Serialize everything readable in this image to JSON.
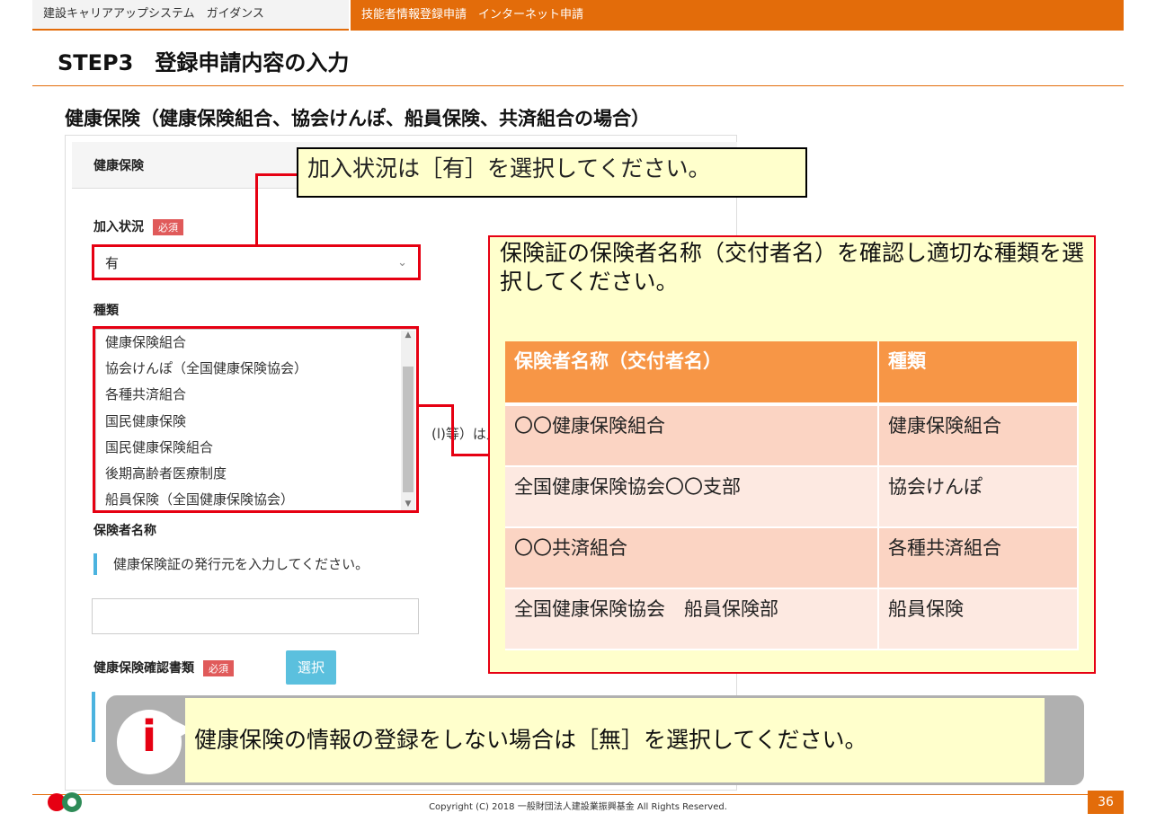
{
  "header": {
    "left_title": "建設キャリアアップシステム　ガイダンス",
    "right_title": "技能者情報登録申請　インターネット申請"
  },
  "step_title": "STEP3　登録申請内容の入力",
  "section_title": "健康保険（健康保険組合、協会けんぽ、船員保険、共済組合の場合）",
  "form": {
    "panel_title": "健康保険",
    "enrollment": {
      "label": "加入状況",
      "required_badge": "必須",
      "value": "有"
    },
    "type": {
      "label": "種類",
      "options": [
        "健康保険組合",
        "協会けんぽ（全国健康保険協会）",
        "各種共済組合",
        "国民健康保険",
        "国民健康保険組合",
        "後期高齢者医療制度",
        "船員保険（全国健康保険協会）"
      ]
    },
    "partial_hidden_text": "(l)等）は入",
    "insurer": {
      "label": "保険者名称",
      "hint": "健康保険証の発行元を入力してください。",
      "value": ""
    },
    "certificate": {
      "label": "健康保険確認書類",
      "required_badge": "必須",
      "select_label": "選択"
    }
  },
  "callout_enrollment": "加入状況は［有］を選択してください。",
  "callout_type": {
    "text": "保険証の保険者名称（交付者名）を確認し適切な種類を選択してください。",
    "table": {
      "headers": [
        "保険者名称（交付者名）",
        "種類"
      ],
      "rows": [
        [
          "〇〇健康保険組合",
          "健康保険組合"
        ],
        [
          "全国健康保険協会〇〇支部",
          "協会けんぽ"
        ],
        [
          "〇〇共済組合",
          "各種共済組合"
        ],
        [
          "全国健康保険協会　船員保険部",
          "船員保険"
        ]
      ]
    }
  },
  "info_banner": {
    "icon": "info-icon",
    "text": "健康保険の情報の登録をしない場合は［無］を選択してください。"
  },
  "footer": {
    "copyright": "Copyright (C) 2018 一般財団法人建設業振興基金 All Rights Reserved.",
    "page_number": "36"
  },
  "colors": {
    "accent": "#e36c0a",
    "highlight": "#e60012",
    "callout_bg": "#ffffcc",
    "table_header": "#f79646"
  }
}
